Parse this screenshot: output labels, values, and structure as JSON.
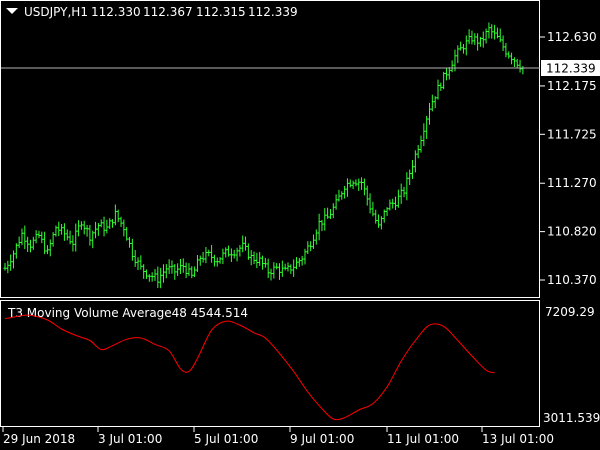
{
  "main_panel": {
    "header": {
      "symbol": "USDJPY,H1",
      "ohlc": [
        "112.330",
        "112.367",
        "112.315",
        "112.339"
      ]
    },
    "price_ticks": [
      "112.630",
      "112.175",
      "111.725",
      "111.270",
      "110.820",
      "110.370"
    ],
    "current_price_label": "112.339"
  },
  "indicator_panel": {
    "title": "T3 Moving Volume Average48 4544.514",
    "max_label": "7209.29",
    "min_label": "3011.539"
  },
  "time_ticks": [
    "29 Jun 2018",
    "3 Jul 01:00",
    "5 Jul 01:00",
    "9 Jul 01:00",
    "11 Jul 01:00",
    "13 Jul 01:00"
  ],
  "colors": {
    "background": "#000000",
    "frame": "#ffffff",
    "bars": "#33ff33",
    "indicator_line": "#ff0000",
    "price_line": "#b4b4b4",
    "text": "#ffffff"
  },
  "chart_data": [
    {
      "type": "bar",
      "title": "USDJPY,H1",
      "subtype": "ohlc",
      "ylim": [
        110.28,
        112.76
      ],
      "x_ticks": [
        "29 Jun 2018",
        "3 Jul 01:00",
        "5 Jul 01:00",
        "9 Jul 01:00",
        "11 Jul 01:00",
        "13 Jul 01:00"
      ],
      "y_ticks": [
        112.63,
        112.175,
        111.725,
        111.27,
        110.82,
        110.37
      ],
      "current_price": 112.339,
      "close_path": [
        [
          0,
          110.48
        ],
        [
          3,
          110.62
        ],
        [
          6,
          110.8
        ],
        [
          9,
          110.7
        ],
        [
          12,
          110.78
        ],
        [
          15,
          110.62
        ],
        [
          18,
          110.86
        ],
        [
          21,
          110.8
        ],
        [
          24,
          110.72
        ],
        [
          27,
          110.92
        ],
        [
          30,
          110.78
        ],
        [
          33,
          110.88
        ],
        [
          36,
          110.85
        ],
        [
          39,
          110.98
        ],
        [
          42,
          110.86
        ],
        [
          45,
          110.62
        ],
        [
          48,
          110.48
        ],
        [
          51,
          110.42
        ],
        [
          54,
          110.38
        ],
        [
          57,
          110.48
        ],
        [
          60,
          110.45
        ],
        [
          63,
          110.5
        ],
        [
          66,
          110.4
        ],
        [
          69,
          110.58
        ],
        [
          72,
          110.6
        ],
        [
          75,
          110.56
        ],
        [
          78,
          110.62
        ],
        [
          81,
          110.64
        ],
        [
          84,
          110.68
        ],
        [
          87,
          110.58
        ],
        [
          90,
          110.55
        ],
        [
          93,
          110.45
        ],
        [
          96,
          110.48
        ],
        [
          99,
          110.45
        ],
        [
          102,
          110.5
        ],
        [
          105,
          110.58
        ],
        [
          108,
          110.72
        ],
        [
          111,
          110.9
        ],
        [
          114,
          110.95
        ],
        [
          117,
          111.08
        ],
        [
          120,
          111.25
        ],
        [
          123,
          111.3
        ],
        [
          126,
          111.28
        ],
        [
          129,
          111.05
        ],
        [
          132,
          110.86
        ],
        [
          135,
          111.05
        ],
        [
          138,
          111.1
        ],
        [
          141,
          111.2
        ],
        [
          144,
          111.45
        ],
        [
          147,
          111.7
        ],
        [
          150,
          111.98
        ],
        [
          153,
          112.15
        ],
        [
          156,
          112.3
        ],
        [
          159,
          112.45
        ],
        [
          162,
          112.55
        ],
        [
          165,
          112.62
        ],
        [
          168,
          112.58
        ],
        [
          171,
          112.7
        ],
        [
          174,
          112.62
        ],
        [
          177,
          112.5
        ],
        [
          180,
          112.42
        ],
        [
          183,
          112.34
        ]
      ]
    },
    {
      "type": "line",
      "title": "T3 Moving Volume Average48 4544.514",
      "ylim": [
        3011.539,
        7209.29
      ],
      "values": [
        [
          0,
          6950
        ],
        [
          5,
          7050
        ],
        [
          9,
          7080
        ],
        [
          15,
          6900
        ],
        [
          20,
          6550
        ],
        [
          25,
          6300
        ],
        [
          30,
          6100
        ],
        [
          34,
          5750
        ],
        [
          38,
          5900
        ],
        [
          43,
          6150
        ],
        [
          48,
          6200
        ],
        [
          53,
          5950
        ],
        [
          58,
          5700
        ],
        [
          62,
          5000
        ],
        [
          65,
          4900
        ],
        [
          68,
          5400
        ],
        [
          73,
          6500
        ],
        [
          78,
          6850
        ],
        [
          83,
          6700
        ],
        [
          88,
          6400
        ],
        [
          92,
          6200
        ],
        [
          97,
          5600
        ],
        [
          102,
          4900
        ],
        [
          107,
          4100
        ],
        [
          112,
          3450
        ],
        [
          116,
          3050
        ],
        [
          120,
          3100
        ],
        [
          125,
          3400
        ],
        [
          130,
          3650
        ],
        [
          135,
          4300
        ],
        [
          140,
          5300
        ],
        [
          145,
          6100
        ],
        [
          150,
          6700
        ],
        [
          155,
          6650
        ],
        [
          160,
          6100
        ],
        [
          165,
          5500
        ],
        [
          170,
          4950
        ],
        [
          173,
          4850
        ]
      ]
    }
  ]
}
